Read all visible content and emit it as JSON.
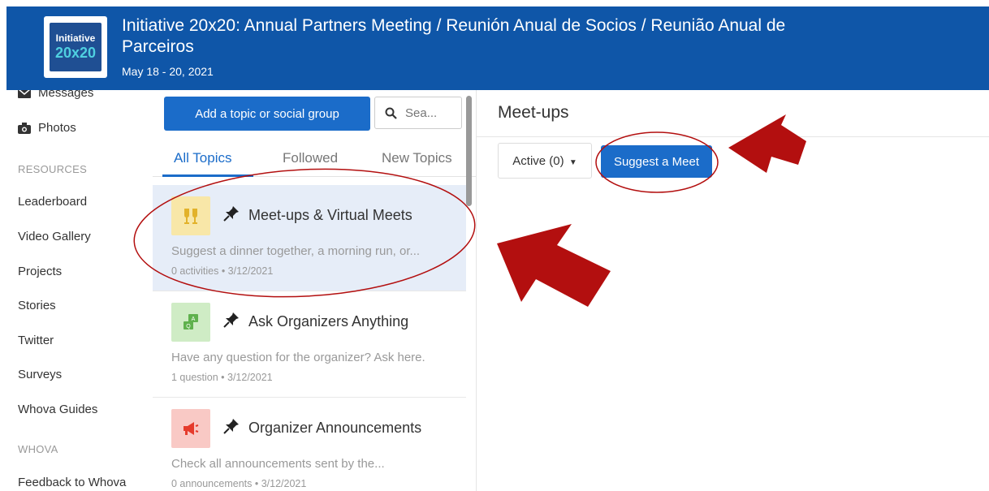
{
  "header": {
    "logo_top": "Initiative",
    "logo_bottom": "20x20",
    "title": "Initiative 20x20: Annual Partners Meeting / Reunión Anual de Socios / Reunião Anual de Parceiros",
    "date": "May 18 - 20, 2021"
  },
  "sidebar": {
    "messages": "Messages",
    "photos": "Photos",
    "resources_label": "RESOURCES",
    "resources": [
      "Leaderboard",
      "Video Gallery",
      "Projects",
      "Stories",
      "Twitter",
      "Surveys",
      "Whova Guides"
    ],
    "whova_label": "WHOVA",
    "feedback": "Feedback to Whova"
  },
  "topics_panel": {
    "add_button": "Add a topic or social group",
    "search_placeholder": "Sea...",
    "tabs": [
      "All Topics",
      "Followed",
      "New Topics"
    ],
    "items": [
      {
        "title": "Meet-ups & Virtual Meets",
        "desc": "Suggest a dinner together, a morning run, or...",
        "meta": "0 activities  •  3/12/2021",
        "icon": "glasses-icon"
      },
      {
        "title": "Ask Organizers Anything",
        "desc": "Have any question for the organizer? Ask here.",
        "meta": "1 question  •  3/12/2021",
        "icon": "qa-icon"
      },
      {
        "title": "Organizer Announcements",
        "desc": "Check all announcements sent by the...",
        "meta": "0 announcements  •  3/12/2021",
        "icon": "megaphone-icon"
      }
    ]
  },
  "meetups": {
    "title": "Meet-ups",
    "active_filter": "Active (0)",
    "suggest_button": "Suggest a Meet"
  },
  "colors": {
    "header_bg": "#0f56a8",
    "primary": "#1b6cc9",
    "annotation_red": "#b30f0f"
  }
}
